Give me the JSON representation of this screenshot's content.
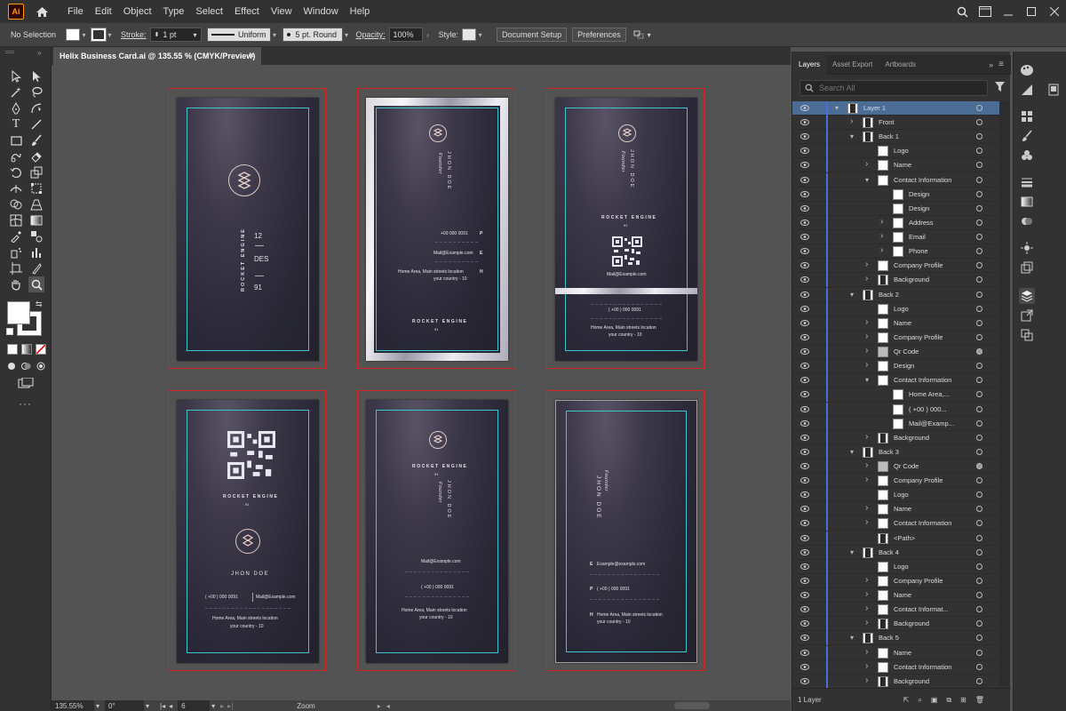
{
  "app": {
    "logo": "Ai"
  },
  "menu": [
    "File",
    "Edit",
    "Object",
    "Type",
    "Select",
    "Effect",
    "View",
    "Window",
    "Help"
  ],
  "control": {
    "selection": "No Selection",
    "stroke_label": "Stroke:",
    "stroke_value": "1 pt",
    "profile": "Uniform",
    "brush": "5 pt. Round",
    "opacity_label": "Opacity:",
    "opacity_value": "100%",
    "style_label": "Style:",
    "document_setup": "Document Setup",
    "preferences": "Preferences"
  },
  "document": {
    "tab_title": "Helix Business Card.ai @ 135.55 % (CMYK/Preview)",
    "close": "×"
  },
  "cards": {
    "c1": {
      "num1": "12",
      "num2": "DES",
      "num3": "91",
      "brand": "ROCKET ENGINE"
    },
    "c2": {
      "name": "JHON DOE",
      "role": "Founder",
      "phone": "+00 000 0091",
      "phone_tag": "P",
      "email": "Mail@Example.com",
      "email_tag": "E",
      "addr1": "Home Area, Main streets location",
      "addr2": "your country - 10",
      "addr_tag": "H",
      "brand": "ROCKET ENGINE",
      "brand_sub": "91"
    },
    "c3": {
      "name": "JHON DOE",
      "role": "Founder",
      "brand": "ROCKET ENGINE",
      "brand_sub": "91",
      "email": "Mail@Example.com",
      "phone": "( +00 ) 000 0091",
      "addr1": "Home Area, Main streets location",
      "addr2": "your country - 10"
    },
    "c4": {
      "brand": "ROCKET ENGINE",
      "brand_sub": "91",
      "name": "JHON DOE",
      "phone": "( +00 ) 000 0091",
      "email": "Mail@Example.com",
      "addr1": "Home Area, Main streets location",
      "addr2": "your country - 10"
    },
    "c5": {
      "brand": "ROCKET ENGINE",
      "brand_sub": "91",
      "name": "JHON DOE",
      "role": "Founder",
      "email": "Mail@Example.com",
      "phone": "( +00 ) 000 0091",
      "addr1": "Home Area, Main streets location",
      "addr2": "your country - 10"
    },
    "c6": {
      "role": "Founder",
      "name": "JHON DOE",
      "email": "Example@example.com",
      "phone": "( +00 ) 000 0091",
      "addr1": "Home Area, Main streets location",
      "addr2": "your country - 10"
    }
  },
  "layers_panel": {
    "tabs": [
      "Layers",
      "Asset Export",
      "Artboards"
    ],
    "search_placeholder": "Search All",
    "footer": "1 Layer",
    "rows": [
      {
        "name": "Layer 1",
        "indent": 0,
        "tw": "v",
        "thumb": "dark",
        "selected": true
      },
      {
        "name": "Front",
        "indent": 1,
        "tw": ">",
        "thumb": "dark"
      },
      {
        "name": "Back 1",
        "indent": 1,
        "tw": "v",
        "thumb": "dark"
      },
      {
        "name": "Logo",
        "indent": 2,
        "tw": "",
        "thumb": "white"
      },
      {
        "name": "Name",
        "indent": 2,
        "tw": ">",
        "thumb": "white"
      },
      {
        "name": "Contact Information",
        "indent": 2,
        "tw": "v",
        "thumb": "white"
      },
      {
        "name": "Design",
        "indent": 3,
        "tw": "",
        "thumb": "white"
      },
      {
        "name": "Design",
        "indent": 3,
        "tw": "",
        "thumb": "white"
      },
      {
        "name": "Address",
        "indent": 3,
        "tw": ">",
        "thumb": "white"
      },
      {
        "name": "Email",
        "indent": 3,
        "tw": ">",
        "thumb": "white"
      },
      {
        "name": "Phone",
        "indent": 3,
        "tw": ">",
        "thumb": "white"
      },
      {
        "name": "Company Profile",
        "indent": 2,
        "tw": ">",
        "thumb": "white"
      },
      {
        "name": "Background",
        "indent": 2,
        "tw": ">",
        "thumb": "dark"
      },
      {
        "name": "Back 2",
        "indent": 1,
        "tw": "v",
        "thumb": "dark"
      },
      {
        "name": "Logo",
        "indent": 2,
        "tw": "",
        "thumb": "white"
      },
      {
        "name": "Name",
        "indent": 2,
        "tw": ">",
        "thumb": "white"
      },
      {
        "name": "Company Profile",
        "indent": 2,
        "tw": ">",
        "thumb": "white"
      },
      {
        "name": "Qr Code",
        "indent": 2,
        "tw": ">",
        "thumb": "qr",
        "filled": true
      },
      {
        "name": "Design",
        "indent": 2,
        "tw": ">",
        "thumb": "white"
      },
      {
        "name": "Contact Information",
        "indent": 2,
        "tw": "v",
        "thumb": "white"
      },
      {
        "name": "Home Area,...",
        "indent": 3,
        "tw": "",
        "thumb": "white"
      },
      {
        "name": "( +00 ) 000...",
        "indent": 3,
        "tw": "",
        "thumb": "white"
      },
      {
        "name": "Mail@Examp...",
        "indent": 3,
        "tw": "",
        "thumb": "white"
      },
      {
        "name": "Background",
        "indent": 2,
        "tw": ">",
        "thumb": "dark"
      },
      {
        "name": "Back 3",
        "indent": 1,
        "tw": "v",
        "thumb": "dark"
      },
      {
        "name": "Qr Code",
        "indent": 2,
        "tw": ">",
        "thumb": "qr",
        "filled": true
      },
      {
        "name": "Company Profile",
        "indent": 2,
        "tw": ">",
        "thumb": "white"
      },
      {
        "name": "Logo",
        "indent": 2,
        "tw": "",
        "thumb": "white"
      },
      {
        "name": "Name",
        "indent": 2,
        "tw": ">",
        "thumb": "white"
      },
      {
        "name": "Contact Information",
        "indent": 2,
        "tw": ">",
        "thumb": "white"
      },
      {
        "name": "<Path>",
        "indent": 2,
        "tw": "",
        "thumb": "dark"
      },
      {
        "name": "Back 4",
        "indent": 1,
        "tw": "v",
        "thumb": "dark"
      },
      {
        "name": "Logo",
        "indent": 2,
        "tw": "",
        "thumb": "white"
      },
      {
        "name": "Company Profile",
        "indent": 2,
        "tw": ">",
        "thumb": "white"
      },
      {
        "name": "Name",
        "indent": 2,
        "tw": ">",
        "thumb": "white"
      },
      {
        "name": "Contact Informat...",
        "indent": 2,
        "tw": ">",
        "thumb": "white"
      },
      {
        "name": "Background",
        "indent": 2,
        "tw": ">",
        "thumb": "dark"
      },
      {
        "name": "Back 5",
        "indent": 1,
        "tw": "v",
        "thumb": "dark"
      },
      {
        "name": "Name",
        "indent": 2,
        "tw": ">",
        "thumb": "white"
      },
      {
        "name": "Contact Information",
        "indent": 2,
        "tw": ">",
        "thumb": "white"
      },
      {
        "name": "Background",
        "indent": 2,
        "tw": ">",
        "thumb": "dark"
      }
    ]
  },
  "status": {
    "zoom": "135.55%",
    "rotation": "0°",
    "artboard": "6",
    "tool": "Zoom"
  }
}
